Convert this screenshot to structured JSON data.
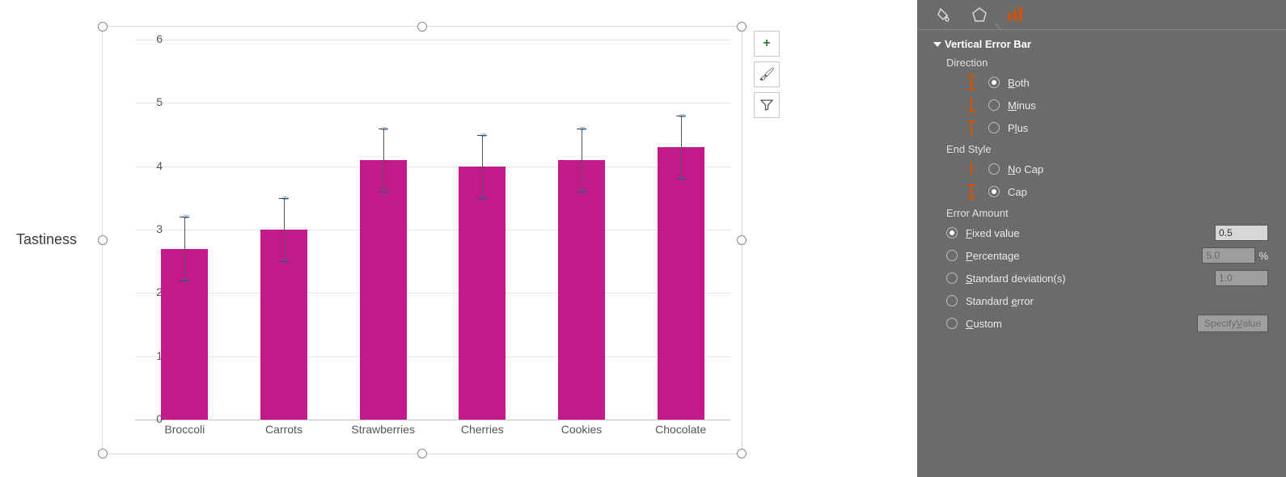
{
  "chart_data": {
    "type": "bar",
    "categories": [
      "Broccoli",
      "Carrots",
      "Strawberries",
      "Cherries",
      "Cookies",
      "Chocolate"
    ],
    "values": [
      2.7,
      3.0,
      4.1,
      4.0,
      4.1,
      4.3
    ],
    "error": {
      "type": "fixed",
      "amount": 0.5,
      "direction": "both",
      "cap": true
    },
    "ylabel": "Tastiness",
    "xlabel": "",
    "ylim": [
      0,
      6
    ],
    "yticks": [
      0,
      1,
      2,
      3,
      4,
      5,
      6
    ],
    "title": "",
    "series_color": "#c4198b"
  },
  "chart_buttons": {
    "add": "+",
    "brush": "🖌",
    "filter": "▼"
  },
  "pane": {
    "header": "Vertical Error Bar",
    "direction_label": "Direction",
    "dir_both": "Both",
    "dir_minus": "Minus",
    "dir_plus": "Plus",
    "endstyle_label": "End Style",
    "nocap": "No Cap",
    "cap": "Cap",
    "erramount_label": "Error Amount",
    "fixed": "Fixed value",
    "fixed_val": "0.5",
    "percent": "Percentage",
    "percent_val": "5.0",
    "percent_sym": "%",
    "stddev": "Standard deviation(s)",
    "stddev_val": "1.0",
    "stderr": "Standard error",
    "custom": "Custom",
    "specify": "Specify Value"
  },
  "ylabel": "Tastiness"
}
